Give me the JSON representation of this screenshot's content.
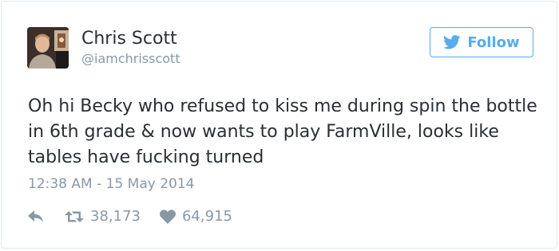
{
  "tweet": {
    "author": {
      "display_name": "Chris Scott",
      "handle": "@iamchrisscott",
      "avatar_icon": "user-avatar"
    },
    "follow_button": {
      "label": "Follow",
      "icon": "twitter-bird-icon",
      "color": "#55acee"
    },
    "text": "Oh hi Becky who refused to kiss me during spin the bottle in 6th grade & now wants to play FarmVille, looks like tables have fucking turned",
    "timestamp": "12:38 AM - 15 May 2014",
    "actions": {
      "reply_icon": "reply-icon",
      "retweet_icon": "retweet-icon",
      "retweet_count": "38,173",
      "like_icon": "heart-icon",
      "like_count": "64,915"
    }
  },
  "colors": {
    "text": "#292f33",
    "secondary": "#8899a6",
    "accent": "#55acee",
    "border": "#e1e8ed"
  }
}
